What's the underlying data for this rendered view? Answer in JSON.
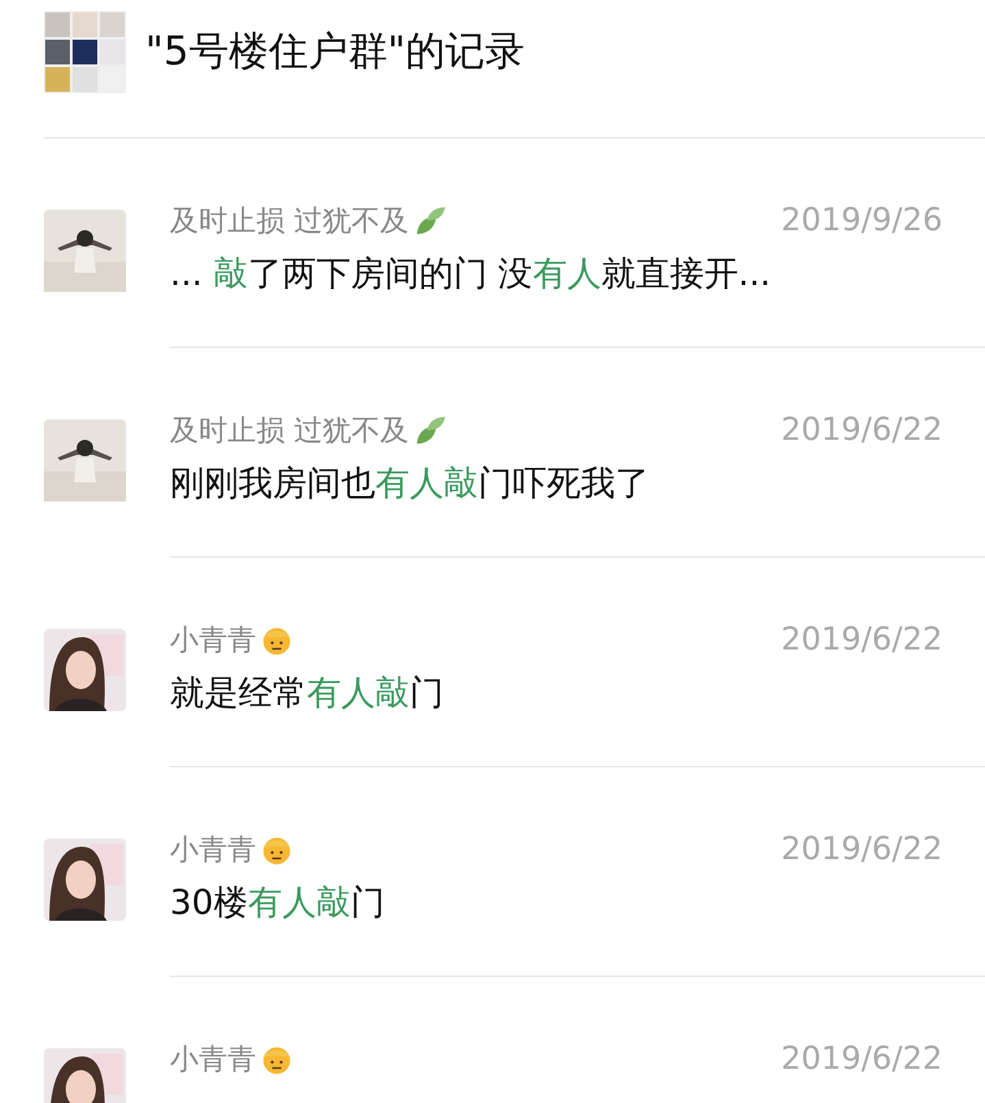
{
  "header": {
    "title": "\"5号楼住户群\"的记录"
  },
  "results": [
    {
      "kind": "silhouette",
      "name": "及时止损 过犹不及",
      "date": "2019/9/26",
      "message": [
        {
          "text": "... ",
          "highlight": false
        },
        {
          "text": "敲",
          "highlight": true
        },
        {
          "text": "了两下房间的门 没",
          "highlight": false
        },
        {
          "text": "有人",
          "highlight": true
        },
        {
          "text": "就直接开...",
          "highlight": false
        }
      ]
    },
    {
      "kind": "silhouette",
      "name": "及时止损 过犹不及",
      "date": "2019/6/22",
      "message": [
        {
          "text": "刚刚我房间也",
          "highlight": false
        },
        {
          "text": "有人敲",
          "highlight": true
        },
        {
          "text": "门吓死我了",
          "highlight": false
        }
      ]
    },
    {
      "kind": "portrait",
      "name": "小青青",
      "date": "2019/6/22",
      "message": [
        {
          "text": "就是经常",
          "highlight": false
        },
        {
          "text": "有人敲",
          "highlight": true
        },
        {
          "text": "门",
          "highlight": false
        }
      ]
    },
    {
      "kind": "portrait",
      "name": "小青青",
      "date": "2019/6/22",
      "message": [
        {
          "text": "30楼",
          "highlight": false
        },
        {
          "text": "有人敲",
          "highlight": true
        },
        {
          "text": "门",
          "highlight": false
        }
      ]
    },
    {
      "kind": "portrait",
      "name": "小青青",
      "date": "2019/6/22"
    }
  ]
}
